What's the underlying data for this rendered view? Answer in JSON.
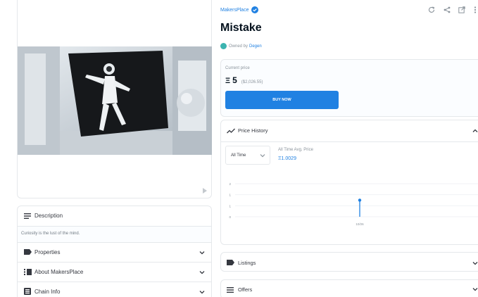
{
  "collection": {
    "name": "MakersPlace"
  },
  "item": {
    "title": "Mistake",
    "owned_by_prefix": "Owned by",
    "owner": "Degen"
  },
  "price": {
    "label": "Current price",
    "value": "5",
    "usd": "($2,026.55)",
    "buy_button": "BUY NOW"
  },
  "price_history": {
    "title": "Price History",
    "filter": "All Time",
    "avg_label": "All Time Avg. Price",
    "avg_value": "Ξ1.0029",
    "y_ticks": [
      "2",
      "1",
      "1",
      "0"
    ],
    "x_tick": "10/26"
  },
  "chart_data": {
    "type": "line",
    "x": [
      "10/26"
    ],
    "series": [
      {
        "values": [
          1.0029
        ]
      }
    ],
    "ylim": [
      0,
      2
    ]
  },
  "left_panels": {
    "description_title": "Description",
    "description_text": "Curiosity is the lust of the mind.",
    "properties": "Properties",
    "about": "About MakersPlace",
    "chain_info": "Chain Info"
  },
  "right_panels": {
    "listings": "Listings",
    "offers": "Offers"
  },
  "colors": {
    "accent": "#2081e2",
    "border": "#e5e8eb",
    "text": "#353840"
  }
}
